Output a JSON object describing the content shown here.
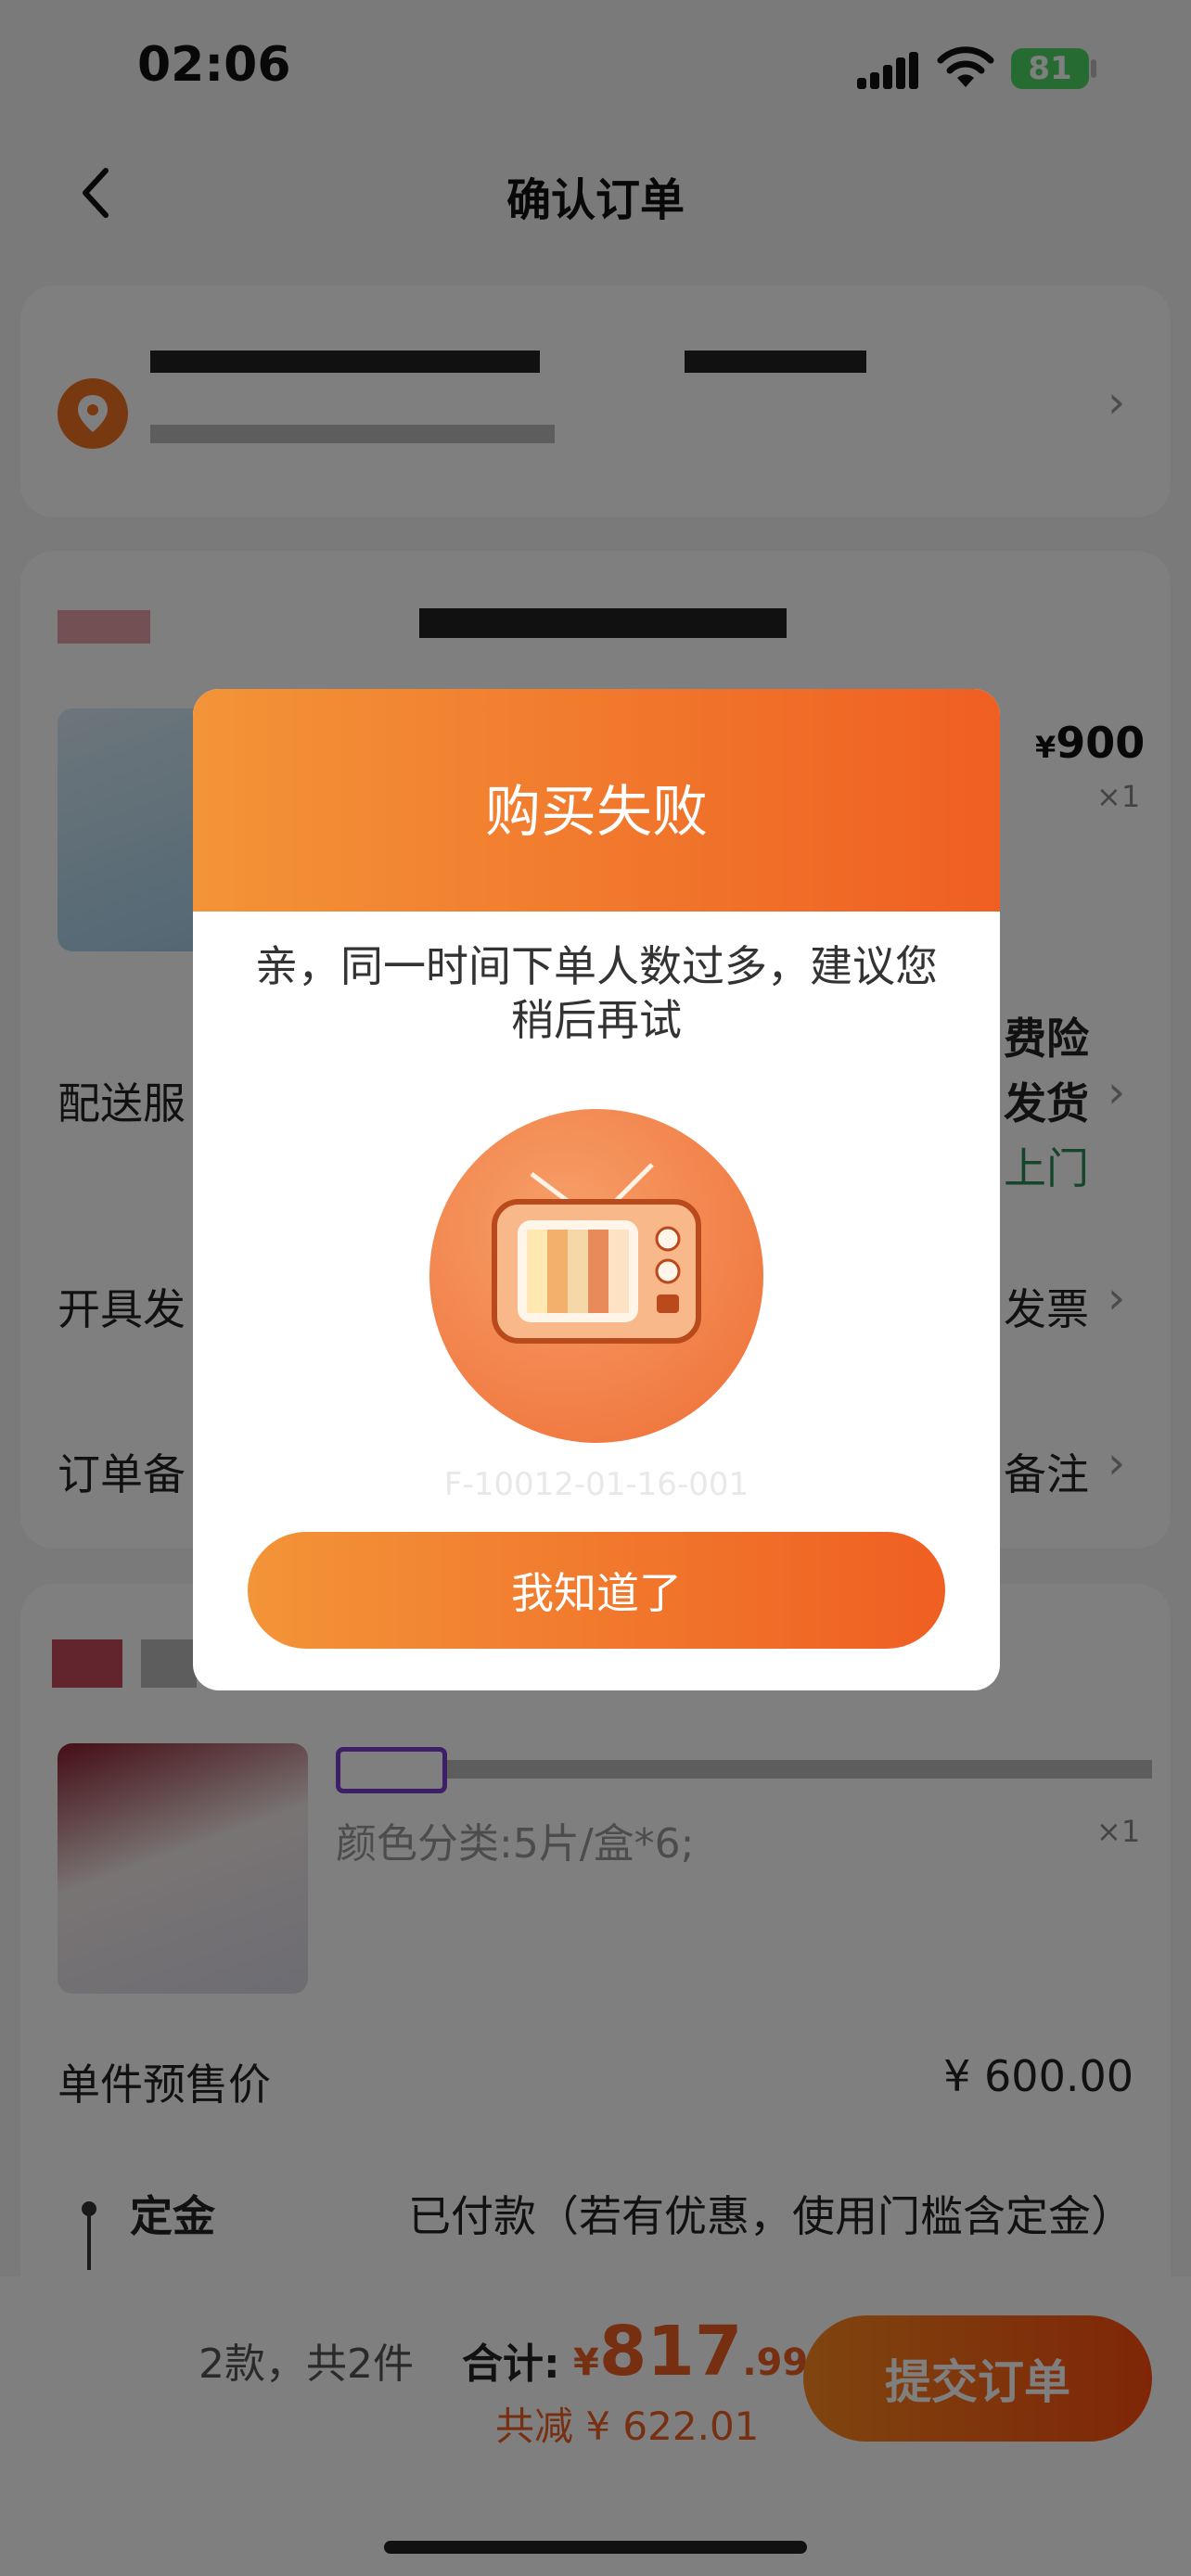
{
  "status_bar": {
    "time": "02:06",
    "battery": "81"
  },
  "header": {
    "title": "确认订单"
  },
  "store1": {
    "price_symbol": "¥",
    "price": "900",
    "qty": "×1",
    "insurance_text": "费险",
    "shipping_text": "发货",
    "pickup_text": "上门"
  },
  "rows": {
    "delivery_label": "配送服",
    "invoice_label": "开具发",
    "invoice_value": "发票",
    "note_label": "订单备",
    "note_value": "备注"
  },
  "store2": {
    "variant": "颜色分类:5片/盒*6;",
    "qty": "×1",
    "presale_label": "单件预售价",
    "presale_price": "¥ 600.00",
    "deposit_label": "定金",
    "deposit_value": "已付款（若有优惠，使用门槛含定金）"
  },
  "bottom": {
    "count_text": "2款，共2件",
    "total_label": "合计:",
    "currency": "¥",
    "total_int": "817",
    "total_dec": ".99",
    "discount": "共减 ¥ 622.01",
    "submit_label": "提交订单"
  },
  "modal": {
    "title": "购买失败",
    "message": "亲，同一时间下单人数过多，建议您稍后再试",
    "error_code": "F-10012-01-16-001",
    "button_label": "我知道了"
  },
  "colors": {
    "accent": "#ef5f22",
    "accent_light": "#f39438",
    "green": "#2e8b57"
  }
}
